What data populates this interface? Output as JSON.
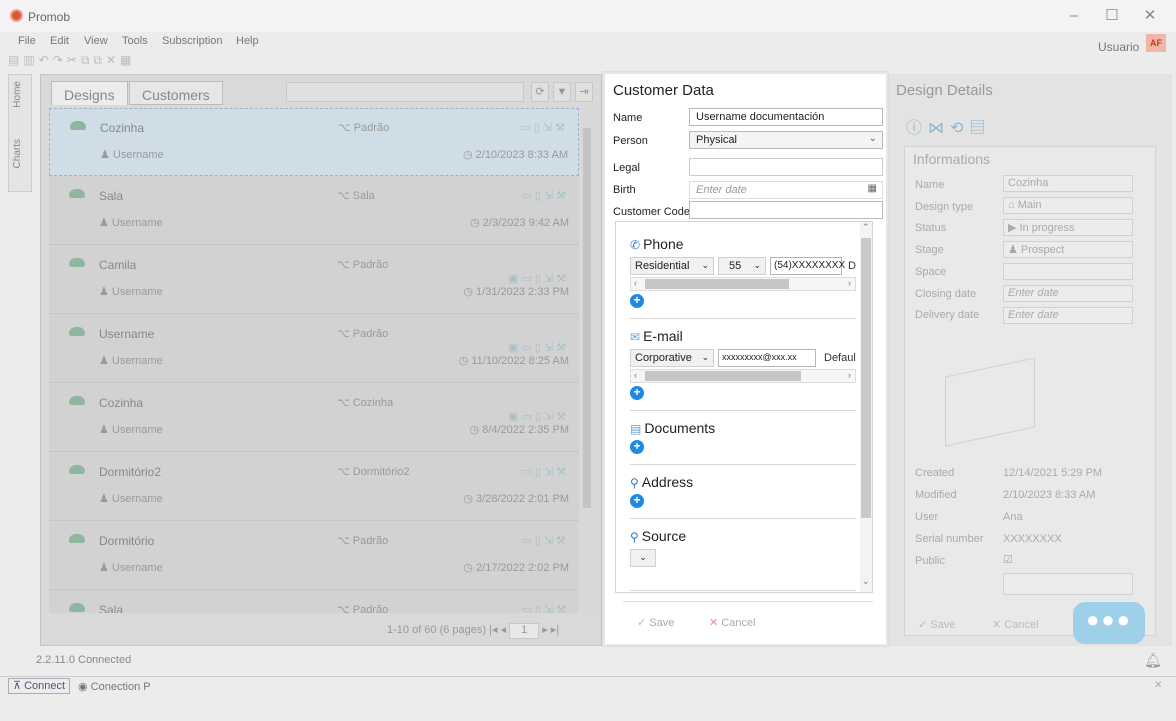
{
  "app": {
    "title": "Promob",
    "version_status": "2.2.11.0 Connected",
    "user": "Usuario",
    "avatar": "AF"
  },
  "menu": [
    "File",
    "Edit",
    "View",
    "Tools",
    "Subscription",
    "Help"
  ],
  "side_tabs": [
    "Home",
    "Charts"
  ],
  "tabs": [
    "Designs",
    "Customers"
  ],
  "designs": [
    {
      "name": "Cozinha",
      "user": "Username",
      "tag": "Padrão",
      "date": "2/10/2023 8:33 AM"
    },
    {
      "name": "Sala",
      "user": "Username",
      "tag": "Sala",
      "date": "2/3/2023 9:42 AM"
    },
    {
      "name": "Camila",
      "user": "Username",
      "tag": "Padrão",
      "date": "1/31/2023 2:33 PM"
    },
    {
      "name": "Username",
      "user": "Username",
      "tag": "Padrão",
      "date": "11/10/2022 8:25 AM"
    },
    {
      "name": "Cozinha",
      "user": "Username",
      "tag": "Cozinha",
      "date": "8/4/2022 2:35 PM"
    },
    {
      "name": "Dormitório2",
      "user": "Username",
      "tag": "Dormitório2",
      "date": "3/28/2022 2:01 PM"
    },
    {
      "name": "Dormitório",
      "user": "Username",
      "tag": "Padrão",
      "date": "2/17/2022 2:02 PM"
    },
    {
      "name": "Sala",
      "user": "",
      "tag": "Padrão",
      "date": ""
    }
  ],
  "pager": {
    "text": "1-10 of 60 (6 pages)",
    "page": "1"
  },
  "status": {
    "connect": "Connect",
    "connection": "Conection P"
  },
  "customer": {
    "title": "Customer Data",
    "name_label": "Name",
    "name_value": "Username documentación",
    "person_label": "Person",
    "person_value": "Physical",
    "legal_label": "Legal",
    "birth_label": "Birth",
    "birth_placeholder": "Enter date",
    "code_label": "Customer Code",
    "phone": {
      "title": "Phone",
      "type": "Residential",
      "ddi": "55",
      "number": "(54)XXXXXXXX",
      "extra": "D"
    },
    "email": {
      "title": "E-mail",
      "type": "Corporative",
      "address": "xxxxxxxxx@xxx.xx",
      "extra": "Defaul"
    },
    "documents_title": "Documents",
    "address_title": "Address",
    "source_title": "Source",
    "save": "Save",
    "cancel": "Cancel"
  },
  "details": {
    "title": "Design Details",
    "section": "Informations",
    "name_label": "Name",
    "name": "Cozinha",
    "type_label": "Design type",
    "type": "Main",
    "status_label": "Status",
    "status": "In progress",
    "stage_label": "Stage",
    "stage": "Prospect",
    "space_label": "Space",
    "closing_label": "Closing date",
    "closing": "Enter date",
    "delivery_label": "Delivery date",
    "delivery": "Enter date",
    "created_label": "Created",
    "created": "12/14/2021 5:29 PM",
    "modified_label": "Modified",
    "modified": "2/10/2023 8:33 AM",
    "user_label": "User",
    "user": "Ana",
    "serial_label": "Serial number",
    "serial": "XXXXXXXX",
    "public_label": "Public",
    "save": "Save",
    "cancel": "Cancel"
  }
}
